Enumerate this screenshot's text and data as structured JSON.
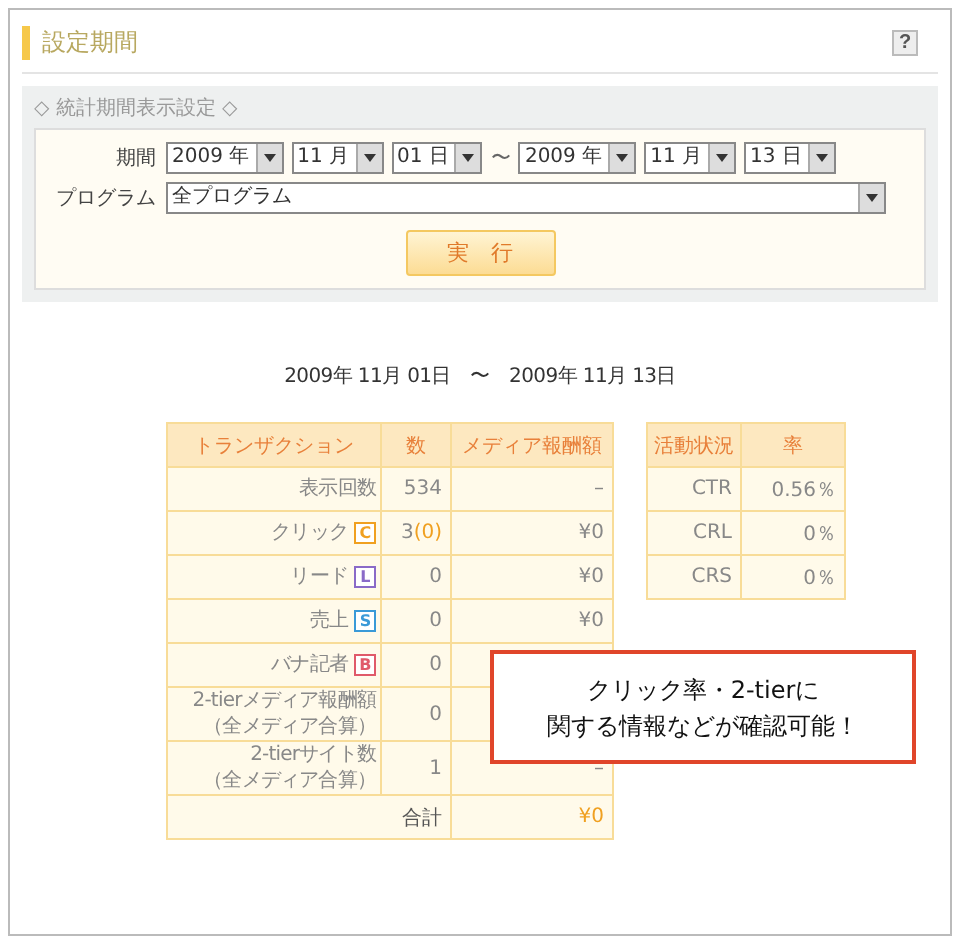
{
  "header": {
    "title": "設定期間",
    "help": "?"
  },
  "filter": {
    "legend": "◇ 統計期間表示設定 ◇",
    "period_label": "期間",
    "from": [
      {
        "value": "2009 年"
      },
      {
        "value": "11 月"
      },
      {
        "value": "01 日"
      }
    ],
    "separator": "〜",
    "to": [
      {
        "value": "2009 年"
      },
      {
        "value": "11 月"
      },
      {
        "value": "13 日"
      }
    ],
    "program_label": "プログラム",
    "program": "全プログラム",
    "run_button": "実　行"
  },
  "range_text": "2009年 11月 01日　〜　2009年 11月 13日",
  "transactions": {
    "columns": [
      "トランザクション",
      "数",
      "メディア報酬額"
    ],
    "rows": [
      {
        "label": [
          "表示回数"
        ],
        "count": "534",
        "fee": "–"
      },
      {
        "label": [
          "クリック"
        ],
        "badge": "C",
        "color": "#f0a020",
        "count": "3",
        "count_extra": "(0)",
        "fee": "¥0"
      },
      {
        "label": [
          "リード"
        ],
        "badge": "L",
        "color": "#8a6ac8",
        "count": "0",
        "fee": "¥0"
      },
      {
        "label": [
          "売上"
        ],
        "badge": "S",
        "color": "#3a9ad8",
        "count": "0",
        "fee": "¥0"
      },
      {
        "label": [
          "バナ記者"
        ],
        "badge": "B",
        "color": "#e05a6a",
        "count": "0"
      },
      {
        "label": [
          "2-tierメディア報酬額",
          "（全メディア合算）"
        ],
        "count": "0"
      },
      {
        "label": [
          "2-tierサイト数",
          "（全メディア合算）"
        ],
        "count": "1",
        "fee": "–"
      }
    ],
    "total_label": "合計",
    "total": "¥0"
  },
  "activity": {
    "columns": [
      "活動状況",
      "率"
    ],
    "rows": [
      {
        "label": "CTR",
        "rate": "0.56％"
      },
      {
        "label": "CRL",
        "rate": "0％"
      },
      {
        "label": "CRS",
        "rate": "0％"
      }
    ]
  },
  "callout": [
    "クリック率・2-tierに",
    "関する情報などが確認可能！"
  ]
}
